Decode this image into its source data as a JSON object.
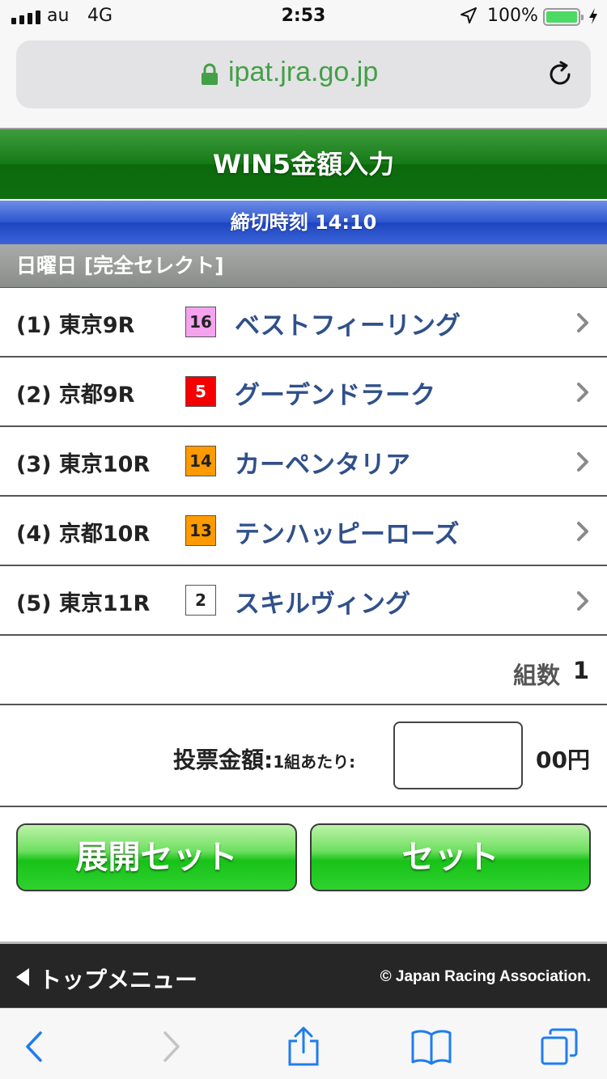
{
  "status_bar": {
    "carrier": "au",
    "network": "4G",
    "time": "2:53",
    "battery_percent": "100%",
    "battery_level": 1.0
  },
  "browser": {
    "url": "ipat.jra.go.jp"
  },
  "page": {
    "title": "WIN5金額入力",
    "deadline": "締切時刻 14:10",
    "day_label": "日曜日 [完全セレクト]"
  },
  "races": [
    {
      "label": "(1) 東京9R",
      "number": "16",
      "horse": "ベストフィーリング",
      "badge_color": "#f5a3ee",
      "number_color": "#222222"
    },
    {
      "label": "(2) 京都9R",
      "number": "5",
      "horse": "グーデンドラーク",
      "badge_color": "#f40000",
      "number_color": "#ffffff"
    },
    {
      "label": "(3) 東京10R",
      "number": "14",
      "horse": "カーペンタリア",
      "badge_color": "#ff9a00",
      "number_color": "#222222"
    },
    {
      "label": "(4) 京都10R",
      "number": "13",
      "horse": "テンハッピーローズ",
      "badge_color": "#ff9a00",
      "number_color": "#222222"
    },
    {
      "label": "(5) 東京11R",
      "number": "2",
      "horse": "スキルヴィング",
      "badge_color": "#ffffff",
      "number_color": "#222222"
    }
  ],
  "count": {
    "label": "組数",
    "value": "1"
  },
  "amount": {
    "label": "投票金額:",
    "sublabel": "1組あたり:",
    "value": "",
    "unit": "00円"
  },
  "buttons": {
    "expand_set": "展開セット",
    "set": "セット"
  },
  "footer": {
    "top_menu": "トップメニュー",
    "copyright": "© Japan Racing Association."
  },
  "colors": {
    "title_green": "#157a15",
    "deadline_blue": "#2c55cf",
    "horse_name": "#30508a",
    "button_green": "#18c218",
    "ios_blue": "#1e7cf2"
  }
}
